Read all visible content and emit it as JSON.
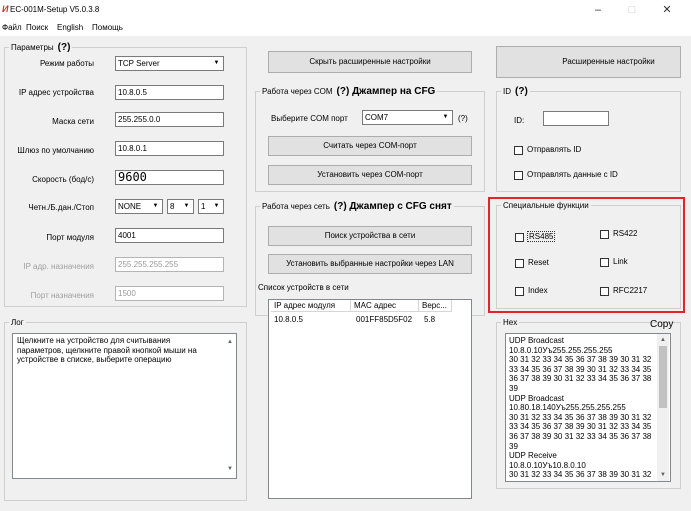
{
  "window": {
    "title": "EC-001M-Setup V5.0.3.8",
    "controls": {
      "minimize": "–",
      "maximize": "□",
      "close": "✕"
    }
  },
  "menu": [
    "Файл",
    "Поиск",
    "English",
    "Помощь"
  ],
  "params": {
    "legend": "Параметры",
    "legend_hint": "(?)",
    "mode_label": "Режим работы",
    "mode_value": "TCP Server",
    "ip_label": "IP адрес устройства",
    "ip_value": "10.8.0.5",
    "mask_label": "Маска сети",
    "mask_value": "255.255.0.0",
    "gateway_label": "Шлюз по умолчанию",
    "gateway_value": "10.8.0.1",
    "baud_label": "Скорость (бод/с)",
    "baud_value": "9600",
    "format_label": "Четн./Б.дан./Стоп",
    "parity_value": "NONE",
    "databits_value": "8",
    "stopbits_value": "1",
    "port_label": "Порт модуля",
    "port_value": "4001",
    "dest_ip_label": "IP адр. назначения",
    "dest_ip_value": "255.255.255.255",
    "dest_port_label": "Порт назначения",
    "dest_port_value": "1500"
  },
  "buttons": {
    "hide_advanced": "Скрыть расширенные настройки",
    "advanced": "Расширенные настройки"
  },
  "com": {
    "legend": "Работа через COM",
    "legend_hint": "(?) Джампер на CFG",
    "port_label": "Выберите COM порт",
    "port_value": "COM7",
    "hint": "(?)",
    "read_button": "Считать через COM-порт",
    "set_button": "Установить через COM-порт"
  },
  "idbox": {
    "legend": "ID",
    "legend_hint": "(?)",
    "id_label": "ID:",
    "id_value": "",
    "send_id_label": "Отправлять ID",
    "send_data_label": "Отправлять данные с ID"
  },
  "net": {
    "legend": "Работа через сеть",
    "legend_hint": "(?) Джампер с CFG снят",
    "search_button": "Поиск устройства в сети",
    "apply_button": "Установить выбранные настройки через LAN",
    "list_title": "Список устройств в сети",
    "columns": [
      "IP адрес модуля",
      "MAC адрес",
      "Верс..."
    ],
    "rows": [
      {
        "ip": "10.8.0.5",
        "mac": "001FF85D5F02",
        "ver": "5.8"
      }
    ]
  },
  "special": {
    "legend": "Специальные функции",
    "rs485": "RS485",
    "rs422": "RS422",
    "reset": "Reset",
    "link": "Link",
    "index": "Index",
    "rfc2217": "RFC2217"
  },
  "log": {
    "legend": "Лог",
    "text": "Щелкните на устройство для считывания параметров, щелкните правой кнопкой мыши на устройстве в списке, выберите операцию"
  },
  "hex": {
    "legend": "Hex",
    "copy": "Copy",
    "lines": [
      "UDP Broadcast",
      "10.8.0.10Уъ255.255.255.255",
      "30 31 32 33 34 35 36 37 38 39 30 31 32",
      "33 34 35 36 37 38 39 30 31 32 33 34 35",
      "36 37 38 39 30 31 32 33 34 35 36 37 38",
      "39",
      "UDP Broadcast",
      "10.80.18.140Уъ255.255.255.255",
      "30 31 32 33 34 35 36 37 38 39 30 31 32",
      "33 34 35 36 37 38 39 30 31 32 33 34 35",
      "36 37 38 39 30 31 32 33 34 35 36 37 38",
      "39",
      "UDP Receive",
      "10.8.0.10Уъ10.8.0.10",
      "30 31 32 33 34 35 36 37 38 39 30 31 32"
    ]
  },
  "icons": {
    "dropdown": "▼",
    "scroll_up": "▲",
    "scroll_down": "▼"
  },
  "colors": {
    "highlight_box": "#e3242b",
    "window_bg": "#f0f0f0"
  }
}
